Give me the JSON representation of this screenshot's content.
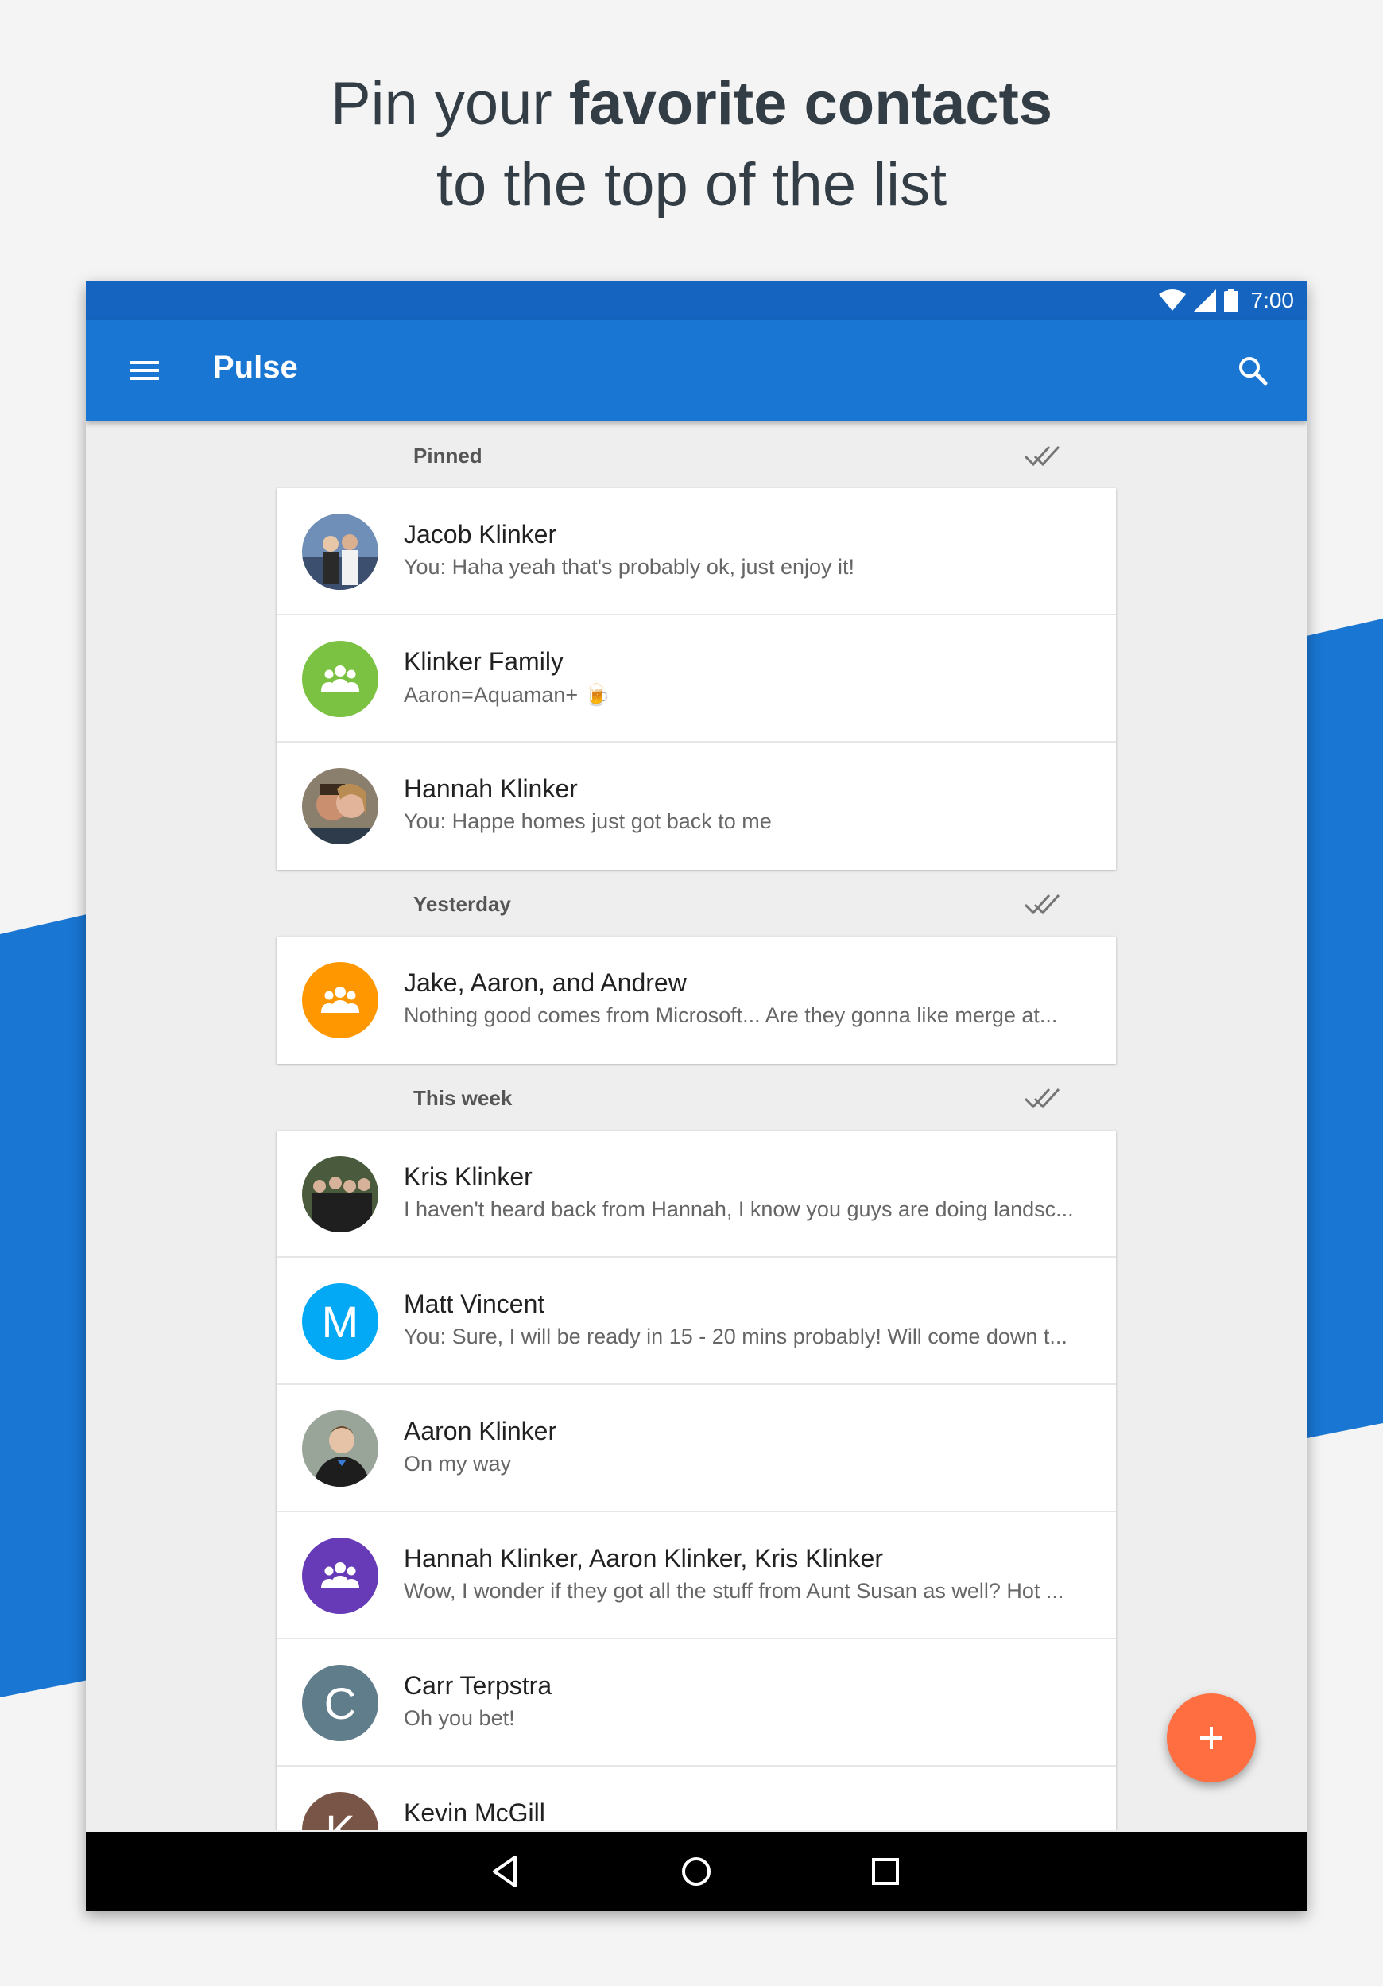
{
  "headline": {
    "line1_prefix": "Pin your",
    "line1_bold": "favorite contacts",
    "line2": "to the top of the list"
  },
  "status_bar": {
    "time": "7:00",
    "icons": [
      "wifi-icon",
      "signal-icon",
      "battery-icon"
    ]
  },
  "toolbar": {
    "title": "Pulse",
    "menu_icon": "menu-icon",
    "search_icon": "search-icon"
  },
  "colors": {
    "primary": "#1976d2",
    "primary_dark": "#1565c0",
    "accent": "#ff6e40",
    "background_stripe": "#1976d2"
  },
  "sections": [
    {
      "label": "Pinned",
      "conversations": [
        {
          "name": "Jacob Klinker",
          "snippet": "You: Haha yeah that's probably ok, just enjoy it!",
          "avatar": "photo"
        },
        {
          "name": "Klinker Family",
          "snippet": "Aaron=Aquaman+ 🍺",
          "avatar": "group",
          "avatar_color": "#7cc242"
        },
        {
          "name": "Hannah Klinker",
          "snippet": "You: Happe homes just got back to me",
          "avatar": "photo"
        }
      ]
    },
    {
      "label": "Yesterday",
      "conversations": [
        {
          "name": "Jake, Aaron, and Andrew",
          "snippet": "Nothing good comes from Microsoft... Are they gonna like merge at...",
          "avatar": "group",
          "avatar_color": "#ff9800"
        }
      ]
    },
    {
      "label": "This week",
      "conversations": [
        {
          "name": "Kris Klinker",
          "snippet": "I haven't heard back from Hannah, I know you guys are doing landsc...",
          "avatar": "photo"
        },
        {
          "name": "Matt Vincent",
          "snippet": "You: Sure, I will be ready in 15 - 20 mins probably! Will come down t...",
          "avatar": "letter",
          "letter": "M",
          "avatar_color": "#03a9f4"
        },
        {
          "name": "Aaron Klinker",
          "snippet": "On my way",
          "avatar": "photo"
        },
        {
          "name": "Hannah Klinker, Aaron Klinker, Kris Klinker",
          "snippet": "Wow, I wonder if they got all the stuff from Aunt Susan as well? Hot ...",
          "avatar": "group",
          "avatar_color": "#673ab7"
        },
        {
          "name": "Carr Terpstra",
          "snippet": "Oh you bet!",
          "avatar": "letter",
          "letter": "C",
          "avatar_color": "#607d8b"
        },
        {
          "name": "Kevin McGill",
          "snippet": "",
          "avatar": "letter",
          "letter": "K",
          "avatar_color": "#795548"
        }
      ]
    }
  ],
  "nav_bar": {
    "buttons": [
      "back-icon",
      "home-icon",
      "recents-icon"
    ]
  },
  "fab": {
    "icon": "plus-icon"
  }
}
